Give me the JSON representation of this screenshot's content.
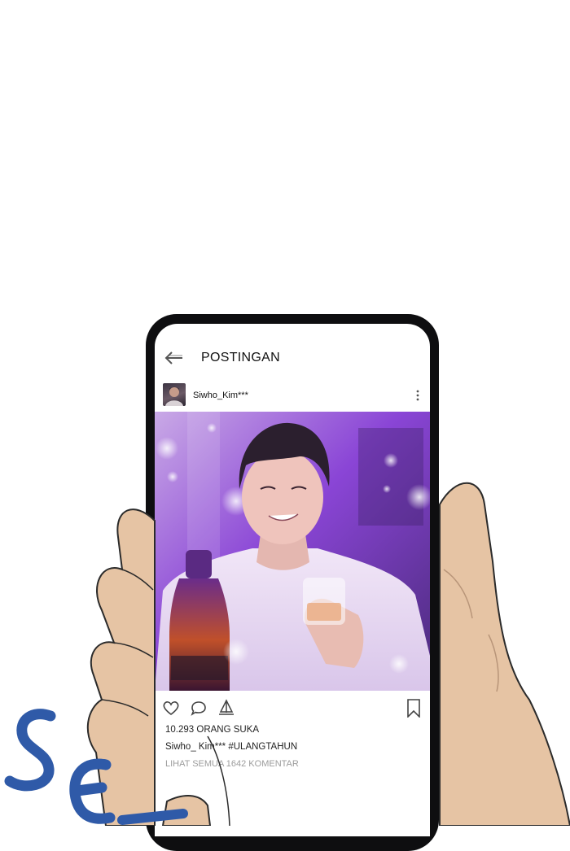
{
  "header": {
    "title": "POSTINGAN"
  },
  "post": {
    "username": "Siwho_Kim***",
    "likes": "10.293 ORANG SUKA",
    "caption_user": "Siwho_ Kim***",
    "caption_tag": "#ULANGTAHUN",
    "comments": "LIHAT SEMUA 1642 KOMENTAR"
  },
  "icons": {
    "back": "back-arrow-icon",
    "more": "more-vertical-icon",
    "like": "heart-icon",
    "comment": "comment-icon",
    "share": "share-icon",
    "save": "bookmark-icon"
  },
  "colors": {
    "accent_purple": "#7a3fd0",
    "phone": "#0e0e10",
    "skin": "#e8c9a8"
  }
}
